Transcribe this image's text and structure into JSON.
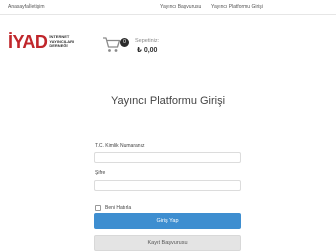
{
  "nav": {
    "home": "Anasayfa",
    "contact": "İletişim",
    "publisher_apply": "Yayıncı Başvurusu",
    "publisher_login": "Yayıncı Platformu Girişi"
  },
  "logo": {
    "mark": "İYAD",
    "text_line1": "İNTERNET",
    "text_line2": "YAYINCILARI",
    "text_line3": "DERNEĞİ"
  },
  "cart": {
    "icon": "shopping-cart-icon",
    "count": "0",
    "label": "Sepetiniz:",
    "total": "₺ 0,00"
  },
  "login": {
    "title": "Yayıncı Platformu Girişi",
    "tc_label": "T.C. Kimlik Numaranız",
    "tc_value": "",
    "password_label": "Şifre",
    "password_value": "",
    "remember_label": "Beni Hatırla",
    "login_button": "Giriş Yap",
    "apply_button": "Kayıt Başvurusu"
  },
  "colors": {
    "brand_red": "#c0262b",
    "primary_button": "#3e8ed0",
    "secondary_button": "#e4e4e4"
  }
}
